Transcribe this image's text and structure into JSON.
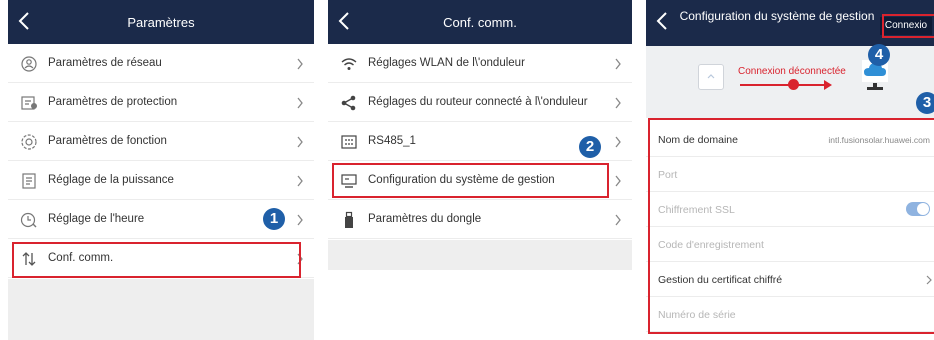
{
  "panel1": {
    "title": "Paramètres",
    "items": [
      {
        "label": "Paramètres de réseau",
        "icon": "network-icon"
      },
      {
        "label": "Paramètres de protection",
        "icon": "protection-icon"
      },
      {
        "label": "Paramètres de fonction",
        "icon": "function-icon"
      },
      {
        "label": "Réglage de la puissance",
        "icon": "power-icon"
      },
      {
        "label": "Réglage de l'heure",
        "icon": "clock-icon"
      },
      {
        "label": "Conf. comm.",
        "icon": "comm-icon"
      }
    ],
    "badge": "1"
  },
  "panel2": {
    "title": "Conf. comm.",
    "items": [
      {
        "label": "Réglages WLAN de l\\'onduleur",
        "icon": "wifi-icon"
      },
      {
        "label": "Réglages du routeur connecté à l\\'onduleur",
        "icon": "share-icon"
      },
      {
        "label": "RS485_1",
        "icon": "rs485-icon"
      },
      {
        "label": "Configuration du système de gestion",
        "icon": "monitor-icon"
      },
      {
        "label": "Paramètres du dongle",
        "icon": "dongle-icon"
      }
    ],
    "badge": "2"
  },
  "panel3": {
    "title": "Configuration du système de gestion",
    "connect_button": "Connexio",
    "status_text": "Connexion déconnectée",
    "badge_top": "4",
    "badge_form": "3",
    "fields": [
      {
        "label": "Nom de domaine",
        "value": "intl.fusionsolar.huawei.com",
        "dim": false
      },
      {
        "label": "Port",
        "value": "",
        "dim": true
      },
      {
        "label": "Chiffrement SSL",
        "value": "",
        "dim": true
      },
      {
        "label": "Code d'enregistrement",
        "value": "",
        "dim": true
      },
      {
        "label": "Gestion du certificat chiffré",
        "value": "",
        "dim": false
      },
      {
        "label": "Numéro de série",
        "value": "",
        "dim": true
      }
    ],
    "ssl_enabled": true
  },
  "colors": {
    "header": "#1b2a4a",
    "highlight": "#d9232e",
    "badge": "#1f5fa8",
    "toggle": "#8fb3e0"
  }
}
